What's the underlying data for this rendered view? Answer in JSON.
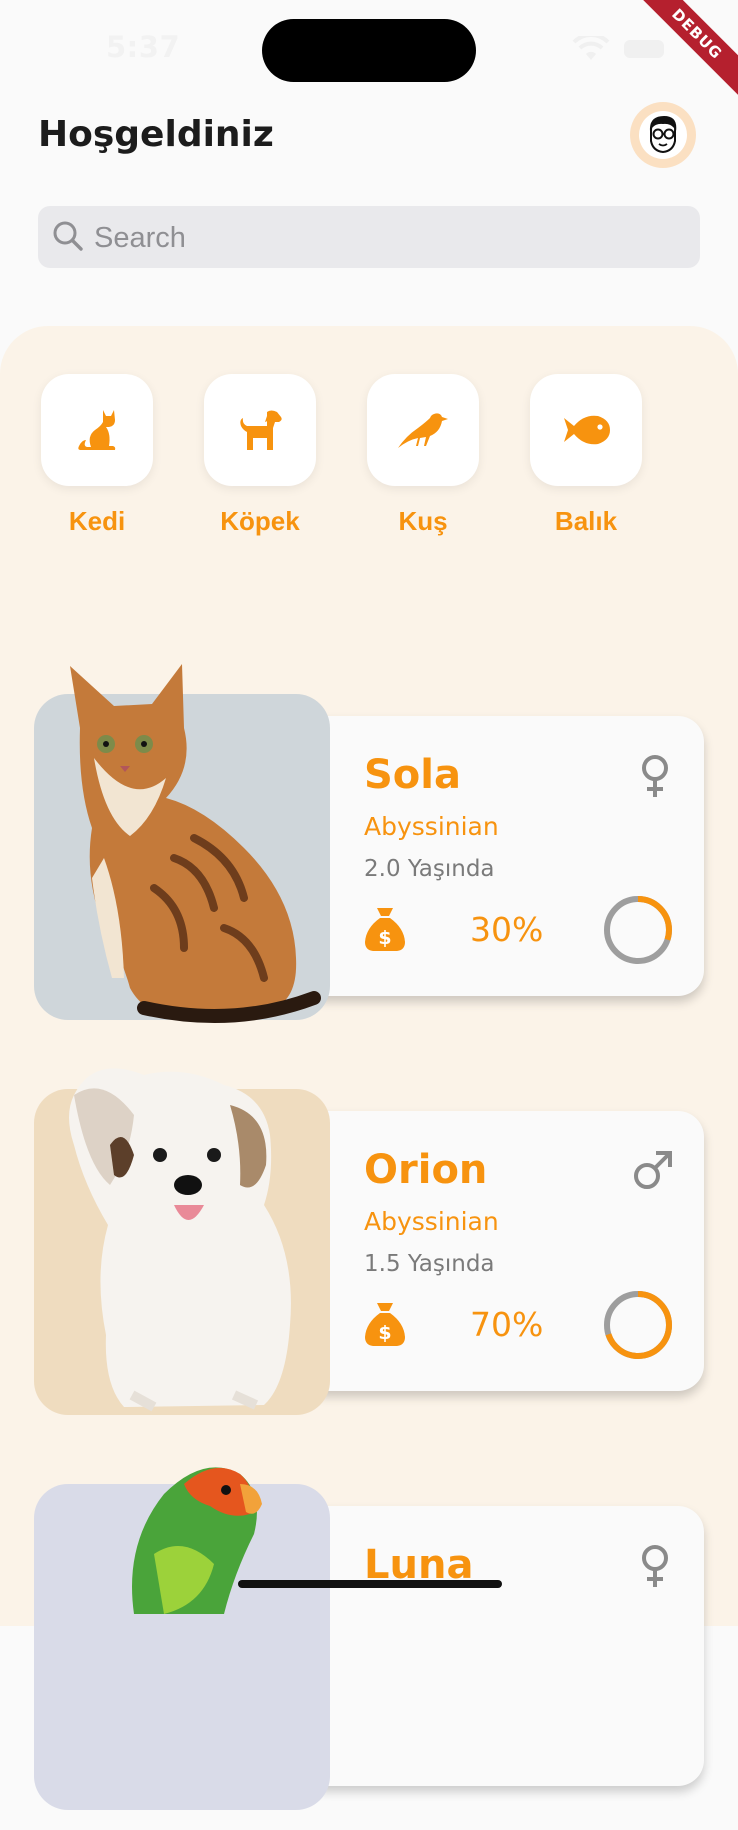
{
  "status_bar": {
    "time": "5:37",
    "debug_label": "DEBUG"
  },
  "header": {
    "title": "Hoşgeldiniz",
    "avatar": "user-avatar-icon"
  },
  "search": {
    "placeholder": "Search",
    "value": ""
  },
  "categories": [
    {
      "label": "Kedi",
      "icon": "cat-icon"
    },
    {
      "label": "Köpek",
      "icon": "dog-icon"
    },
    {
      "label": "Kuş",
      "icon": "bird-icon"
    },
    {
      "label": "Balık",
      "icon": "fish-icon"
    }
  ],
  "pets": [
    {
      "name": "Sola",
      "breed": "Abyssinian",
      "age": "2.0 Yaşında",
      "price_percent": "30%",
      "progress": 0.3,
      "gender": "female",
      "image": "cat-photo",
      "bg": "#cfd6da"
    },
    {
      "name": "Orion",
      "breed": "Abyssinian",
      "age": "1.5 Yaşında",
      "price_percent": "70%",
      "progress": 0.7,
      "gender": "male",
      "image": "dog-photo",
      "bg": "#efdcbf"
    },
    {
      "name": "Luna",
      "gender": "female",
      "image": "parrot-photo",
      "bg": "#d9dbe8"
    }
  ],
  "colors": {
    "accent": "#f7930f",
    "panel": "#fbf3e8",
    "ring_track": "#9e9e9e"
  }
}
